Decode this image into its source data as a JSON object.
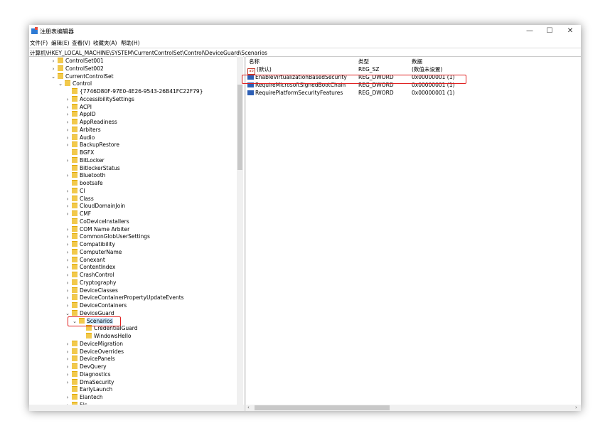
{
  "window": {
    "title": "注册表编辑器",
    "minimize": "—",
    "maximize": "☐",
    "close": "✕"
  },
  "menu": [
    "文件(F)",
    "编辑(E)",
    "查看(V)",
    "收藏夹(A)",
    "帮助(H)"
  ],
  "address": "计算机\\HKEY_LOCAL_MACHINE\\SYSTEM\\CurrentControlSet\\Control\\DeviceGuard\\Scenarios",
  "tree": [
    {
      "label": "ControlSet001",
      "arrow": "›",
      "level": 2
    },
    {
      "label": "ControlSet002",
      "arrow": "›",
      "level": 2
    },
    {
      "label": "CurrentControlSet",
      "arrow": "⌄",
      "level": 2
    },
    {
      "label": "Control",
      "arrow": "⌄",
      "level": 3
    },
    {
      "label": "{7746D80F-97E0-4E26-9543-26B41FC22F79}",
      "arrow": "",
      "level": 4
    },
    {
      "label": "AccessibilitySettings",
      "arrow": "›",
      "level": 4
    },
    {
      "label": "ACPI",
      "arrow": "›",
      "level": 4
    },
    {
      "label": "AppID",
      "arrow": "›",
      "level": 4
    },
    {
      "label": "AppReadiness",
      "arrow": "›",
      "level": 4
    },
    {
      "label": "Arbiters",
      "arrow": "›",
      "level": 4
    },
    {
      "label": "Audio",
      "arrow": "›",
      "level": 4
    },
    {
      "label": "BackupRestore",
      "arrow": "›",
      "level": 4
    },
    {
      "label": "BGFX",
      "arrow": "",
      "level": 4
    },
    {
      "label": "BitLocker",
      "arrow": "›",
      "level": 4
    },
    {
      "label": "BitlockerStatus",
      "arrow": "",
      "level": 4
    },
    {
      "label": "Bluetooth",
      "arrow": "›",
      "level": 4
    },
    {
      "label": "bootsafe",
      "arrow": "",
      "level": 4
    },
    {
      "label": "CI",
      "arrow": "›",
      "level": 4
    },
    {
      "label": "Class",
      "arrow": "›",
      "level": 4
    },
    {
      "label": "CloudDomainJoin",
      "arrow": "›",
      "level": 4
    },
    {
      "label": "CMF",
      "arrow": "›",
      "level": 4
    },
    {
      "label": "CoDeviceInstallers",
      "arrow": "",
      "level": 4
    },
    {
      "label": "COM Name Arbiter",
      "arrow": "›",
      "level": 4
    },
    {
      "label": "CommonGlobUserSettings",
      "arrow": "›",
      "level": 4
    },
    {
      "label": "Compatibility",
      "arrow": "›",
      "level": 4
    },
    {
      "label": "ComputerName",
      "arrow": "›",
      "level": 4
    },
    {
      "label": "Conexant",
      "arrow": "›",
      "level": 4
    },
    {
      "label": "ContentIndex",
      "arrow": "›",
      "level": 4
    },
    {
      "label": "CrashControl",
      "arrow": "›",
      "level": 4
    },
    {
      "label": "Cryptography",
      "arrow": "›",
      "level": 4
    },
    {
      "label": "DeviceClasses",
      "arrow": "›",
      "level": 4
    },
    {
      "label": "DeviceContainerPropertyUpdateEvents",
      "arrow": "›",
      "level": 4
    },
    {
      "label": "DeviceContainers",
      "arrow": "›",
      "level": 4
    },
    {
      "label": "DeviceGuard",
      "arrow": "⌄",
      "level": 4
    },
    {
      "label": "Scenarios",
      "arrow": "⌄",
      "level": 5,
      "selected": true
    },
    {
      "label": "CredentialGuard",
      "arrow": "",
      "level": 6
    },
    {
      "label": "WindowsHello",
      "arrow": "",
      "level": 6
    },
    {
      "label": "DeviceMigration",
      "arrow": "›",
      "level": 4
    },
    {
      "label": "DeviceOverrides",
      "arrow": "›",
      "level": 4
    },
    {
      "label": "DevicePanels",
      "arrow": "›",
      "level": 4
    },
    {
      "label": "DevQuery",
      "arrow": "›",
      "level": 4
    },
    {
      "label": "Diagnostics",
      "arrow": "›",
      "level": 4
    },
    {
      "label": "DmaSecurity",
      "arrow": "›",
      "level": 4
    },
    {
      "label": "EarlyLaunch",
      "arrow": "",
      "level": 4
    },
    {
      "label": "Elantech",
      "arrow": "›",
      "level": 4
    },
    {
      "label": "Els",
      "arrow": "›",
      "level": 4
    }
  ],
  "columns": {
    "name": "名称",
    "type": "类型",
    "data": "数据"
  },
  "values": [
    {
      "name": "(默认)",
      "type": "REG_SZ",
      "data": "(数值未设置)",
      "icon": "string-value-icon"
    },
    {
      "name": "EnableVirtualizationBasedSecurity",
      "type": "REG_DWORD",
      "data": "0x00000001 (1)",
      "icon": "dword-value-icon"
    },
    {
      "name": "RequireMicrosoftSignedBootChain",
      "type": "REG_DWORD",
      "data": "0x00000001 (1)",
      "icon": "dword-value-icon"
    },
    {
      "name": "RequirePlatformSecurityFeatures",
      "type": "REG_DWORD",
      "data": "0x00000001 (1)",
      "icon": "dword-value-icon"
    }
  ],
  "colors": {
    "highlight": "#e02020",
    "selection": "#cce8ff",
    "folder": "#f2c94c"
  }
}
